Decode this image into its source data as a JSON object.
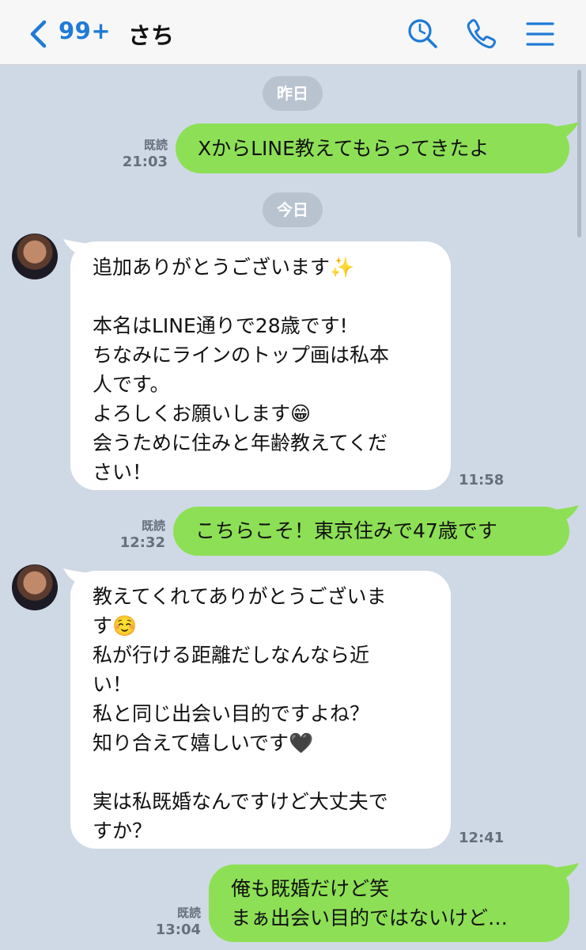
{
  "header": {
    "unread_count": "99+",
    "chat_name": "さち"
  },
  "dates": {
    "yesterday": "昨日",
    "today": "今日"
  },
  "messages": [
    {
      "direction": "sent",
      "read": "既読",
      "time": "21:03",
      "text": "XからLINE教えてもらってきたよ"
    },
    {
      "direction": "received",
      "time": "11:58",
      "text": "追加ありがとうございます✨\n\n本名はLINE通りで28歳です!\nちなみにラインのトップ画は私本\n人です。\nよろしくお願いします😁\n会うために住みと年齢教えてくだ\nさい！"
    },
    {
      "direction": "sent",
      "read": "既読",
      "time": "12:32",
      "text": "こちらこそ！東京住みで47歳です"
    },
    {
      "direction": "received",
      "time": "12:41",
      "text": "教えてくれてありがとうございま\nす☺️\n私が行ける距離だしなんなら近\nい！\n私と同じ出会い目的ですよね？\n知り合えて嬉しいです🖤\n\n実は私既婚なんですけど大丈夫で\nすか？"
    },
    {
      "direction": "sent",
      "read": "既読",
      "time": "13:04",
      "text": "俺も既婚だけど笑\nまぁ出会い目的ではないけど…"
    }
  ],
  "colors": {
    "background": "#cfd9e5",
    "sent_bubble": "#8de055",
    "received_bubble": "#ffffff",
    "accent": "#1f7bd6"
  },
  "icons": [
    "back-chevron-icon",
    "search-icon",
    "phone-icon",
    "menu-icon"
  ]
}
